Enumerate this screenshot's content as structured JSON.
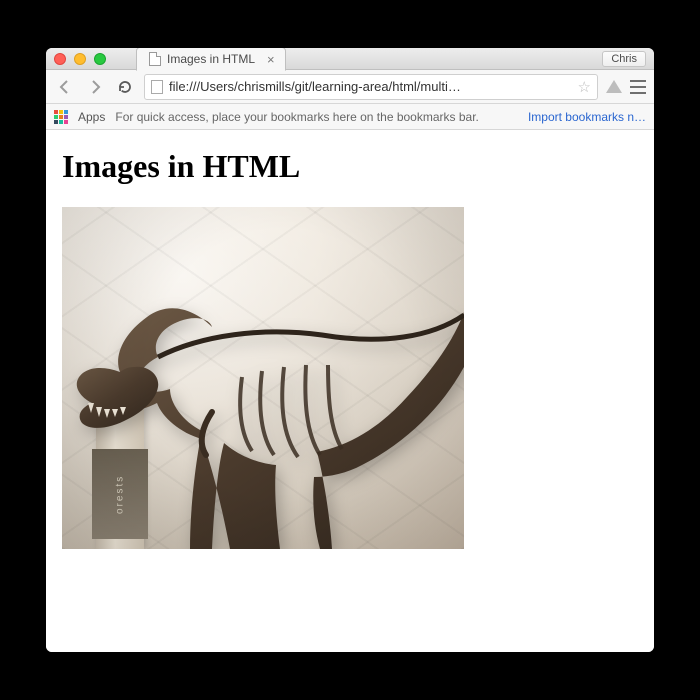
{
  "window": {
    "profile_label": "Chris"
  },
  "tab": {
    "title": "Images in HTML"
  },
  "toolbar": {
    "url": "file:///Users/chrismills/git/learning-area/html/multi…"
  },
  "bookmarks_bar": {
    "apps_label": "Apps",
    "hint_text": "For quick access, place your bookmarks here on the bookmarks bar.",
    "import_link": "Import bookmarks n…"
  },
  "page": {
    "heading": "Images in HTML",
    "image_alt": "A T-Rex skeleton on display in a museum hall",
    "banner_text": "orests"
  }
}
